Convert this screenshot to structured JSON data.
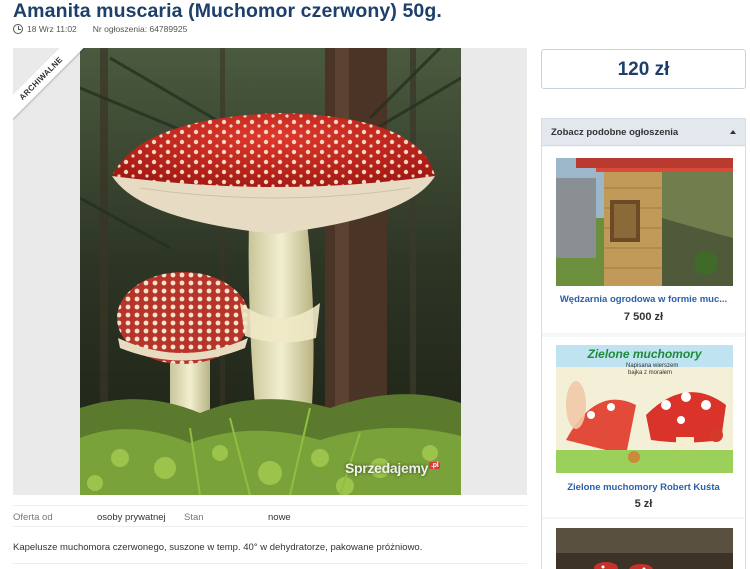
{
  "listing": {
    "title": "Amanita muscaria (Muchomor czerwony) 50g.",
    "date": "18 Wrz 11:02",
    "ad_number": "Nr ogłoszenia: 64789925",
    "badge": "ARCHIWALNE",
    "watermark": "Sprzedajemy",
    "watermark_suffix": ".pl",
    "price": "120 zł",
    "params": {
      "offer_label": "Oferta od",
      "offer_value": "osoby prywatnej",
      "condition_label": "Stan",
      "condition_value": "nowe"
    },
    "description": "Kapelusze muchomora czerwonego, suszone w temp. 40° w dehydratorze, pakowane próżniowo."
  },
  "similar": {
    "heading": "Zobacz podobne ogłoszenia",
    "items": [
      {
        "title": "Wędzarnia ogrodowa w formie muc...",
        "price": "7 500 zł"
      },
      {
        "title": "Zielone muchomory Robert Kuśta",
        "price": "5 zł",
        "image_text_1": "Zielone muchomory",
        "image_text_2": "Napisana wierszem",
        "image_text_3": "bajka z morałem"
      }
    ]
  },
  "icons": {
    "clock": "clock-icon",
    "collapse": "chevron-up-icon"
  }
}
